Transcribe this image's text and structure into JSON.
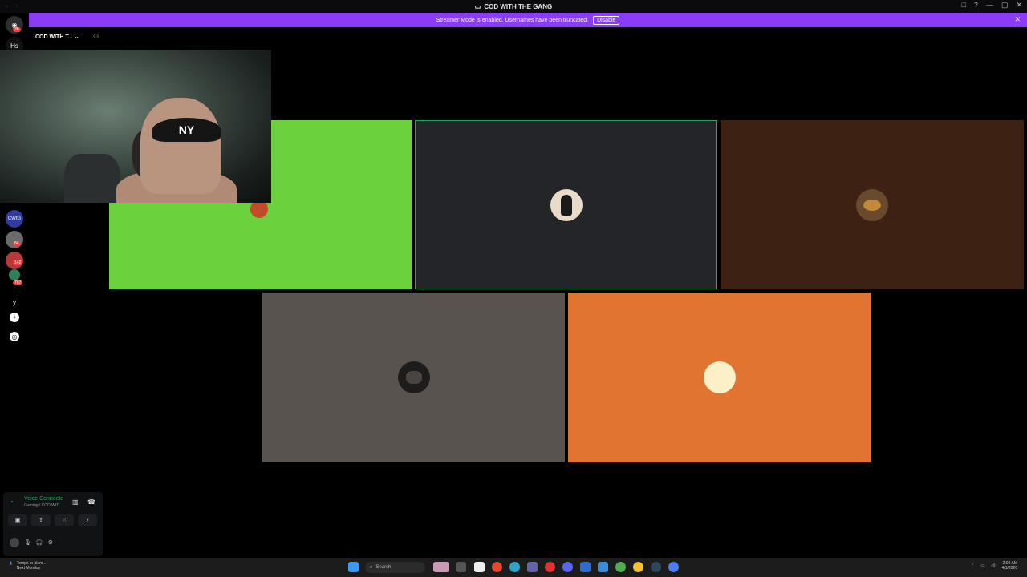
{
  "window": {
    "title": "COD WITH THE GANG",
    "controls": [
      "□",
      "?",
      "—",
      "▢",
      "✕"
    ]
  },
  "banner": {
    "text": "Streamer Mode is enabled. Usernames have been truncated.",
    "disable_label": "Disable",
    "color": "#8a3cf6"
  },
  "guild_rail": {
    "home_badge": "38",
    "dm_label": "Hs",
    "badges": [
      "84",
      "142",
      "767"
    ],
    "server_label": "CWtG"
  },
  "channel_sidebar": {
    "server_name": "COD WITH T...",
    "voice_status": "Voice Connecte",
    "voice_channel": "Gaming / COD WIT..."
  },
  "call_grid": {
    "tiles": [
      {
        "color": "#6bd13c",
        "avatar": "red-figure-avatar"
      },
      {
        "color": "#232528",
        "avatar": "dark-figure-avatar",
        "speaking": true
      },
      {
        "color": "#3d2214",
        "avatar": "cowboy-avatar"
      },
      {
        "color": "#58534f",
        "avatar": "dark-animal-avatar"
      },
      {
        "color": "#e07430",
        "avatar": "sun-avatar"
      }
    ],
    "speaking_color": "#23a55a"
  },
  "webcam": {
    "cap_logo": "NY"
  },
  "taskbar": {
    "weather_line1": "Temps to plum...",
    "weather_line2": "Next Monday",
    "search_placeholder": "Search",
    "time": "2:09 AM",
    "date": "4/1/2026"
  }
}
